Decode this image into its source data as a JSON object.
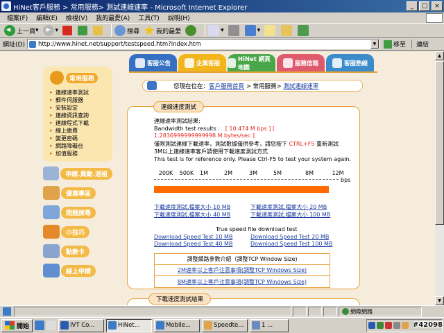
{
  "window": {
    "title": "HiNet客戶服務 > 常用服務> 測試連線速率 - Microsoft Internet Explorer",
    "minimize": "_",
    "maximize": "□",
    "close": "×"
  },
  "menubar": [
    "檔案(F)",
    "編輯(E)",
    "檢視(V)",
    "我的最愛(A)",
    "工具(T)",
    "說明(H)"
  ],
  "toolbar": {
    "back": "上一頁",
    "search": "搜尋",
    "favorites": "我的最愛"
  },
  "addressbar": {
    "label": "網址(D)",
    "url": "http://www.hinet.net/support/testspeed.htm?index.htm",
    "go": "移至",
    "links": "連結"
  },
  "tabs": [
    "客服公告",
    "企業客服",
    "HiNet 網頁地圖",
    "服務信箱",
    "客服熱線"
  ],
  "sidebar": {
    "header": "常用服務",
    "items": [
      "連線速率測試",
      "郵件伺服器",
      "安裝設定",
      "連線資訊查詢",
      "連線程式下載",
      "線上繳費",
      "變更密碼",
      "網路障礙台",
      "加值服務"
    ],
    "buttons": [
      "申請.異動.退租",
      "優惠專區",
      "問題搜尋",
      "小技巧",
      "點數卡",
      "線上申請"
    ]
  },
  "breadcrumb": {
    "prefix": "您現在位在：",
    "link1": "客戶服務首頁",
    "sep": " > 常用服務> ",
    "link2": "測試連線速率"
  },
  "panel": {
    "heading": "連線速度測試",
    "result_title": "連線速率測試結果:",
    "result_label": "Bandwidth test results :",
    "result_value": "[ 10.474 M bps ] [ 1.2836999999999998 M bytes/sec ]",
    "note_cn": "僅限測試連線下載速率，測試數據僅供參考，請您按下",
    "note_key": "CTRL+F5",
    "note_cn_end": "重新測試",
    "note_cn2": "3M以上連線速率客戶請使用下載速度測試方式",
    "note_en": "This test is for reference only. Please Ctrl-F5 to test your system again.",
    "bps": "bps"
  },
  "scale_ticks": [
    "200K",
    "500K",
    "1M",
    "2M",
    "3M",
    "5M",
    "8M",
    "12M"
  ],
  "downloads_cn": [
    "下載速度測試,檔案大小 10 MB",
    "下載速度測試,檔案大小 20 MB",
    "下載速度測試,檔案大小 40 MB",
    "下載速度測試,檔案大小 100 MB"
  ],
  "downloads_en_title": "True speed file download test",
  "downloads_en": [
    "Download Speed Test 10 MB",
    "Download Speed Test 20 MB",
    "Download Speed Test 40 MB",
    "Download Speed Test 100 MB"
  ],
  "tuning": {
    "title": "調整網路參數介紹（調整TCP Window Size)",
    "link1": "2M速率以上客戶注意事項(調整TCP Windows Size)",
    "link2": "8M速率以上客戶注意事項(調整TCP Windows Size)"
  },
  "panel2_heading": "下載速度測試結果",
  "statusbar": {
    "zone": "網際網路"
  },
  "taskbar": {
    "start": "開始",
    "tasks": [
      "IVT Co...",
      "HiNet...",
      "Mobile...",
      "Speedte...",
      "1 ..."
    ],
    "watermark": "#42098"
  },
  "colors": {
    "accent_orange": "#ff6b00",
    "link_blue": "#1b3c9f",
    "result_red": "#e2261b",
    "titlebar": "#0a246a"
  },
  "speed_bar": {
    "measured_mbps": 10.474,
    "scale_max_mbps": 12
  }
}
